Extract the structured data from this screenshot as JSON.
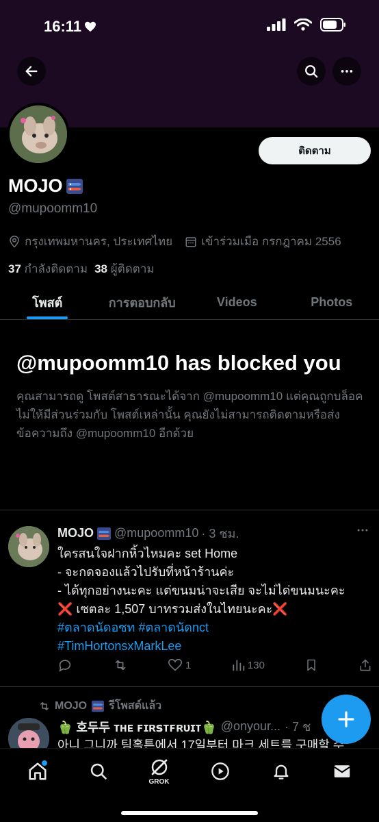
{
  "status_bar": {
    "time": "16:11"
  },
  "profile": {
    "display_name": "MOJO",
    "handle": "@mupoomm10",
    "follow_label": "ติดตาม",
    "location": "กรุงเทพมหานคร, ประเทศไทย",
    "joined": "เข้าร่วมเมือ กรกฎาคม 2556",
    "following_count": "37",
    "following_label": "กำลังติดตาม",
    "followers_count": "38",
    "followers_label": "ผู้ติดตาม"
  },
  "tabs": [
    {
      "label": "โพสต์",
      "active": true
    },
    {
      "label": "การตอบกลับ",
      "active": false
    },
    {
      "label": "Videos",
      "active": false
    },
    {
      "label": "Photos",
      "active": false
    }
  ],
  "blocked": {
    "title": "@mupoomm10 has blocked you",
    "description": "คุณสามารถดู โพสต์สาธารณะได้จาก @mupoomm10 แต่คุณถูกบล็อคไม่ให้มีส่วนร่วมกับ โพสต์เหล่านั้น คุณยังไม่สามารถติดตามหรือส่งข้อความถึง @mupoomm10 อีกด้วย"
  },
  "post": {
    "name": "MOJO",
    "handle": "@mupoomm10",
    "time": "· 3 ชม.",
    "line1": "ใครสนใจฝากหิ้วไหมคะ set Home",
    "line2": "- จะกดจองแล้วไปรับที่หน้าร้านค่ะ",
    "line3": "- ได้ทุกอย่างนะคะ แต่ขนมน่าจะเสีย จะไม่ได่ขนมนะคะ",
    "line4_mark": "❌",
    "line4": " เซตละ 1,507 บาทรวมส่งในไทยนะคะ",
    "tag1": "#ตลาดนัดอซท",
    "tag2": "#ตลาดนัดnct",
    "tag3": "#TimHortonsxMarkLee",
    "likes": "1",
    "views": "130"
  },
  "repost": {
    "reposter": "MOJO",
    "reposted_label": "รีโพสต์แล้ว",
    "author": "🫑 호두두 ᴛʜᴇ ꜰɪʀꜱᴛꜰʀᴜɪᴛ🫑",
    "handle": "@onyour...",
    "time": "· 7 ช",
    "text": "아니 그니까 팀홀튼에서 17일부터 마크 세트를 구매할 수"
  },
  "nav": {
    "grok_label": "GROK"
  },
  "colors": {
    "accent": "#1d9bf0",
    "banner": "#1c0a22",
    "background": "#000000"
  },
  "icons": [
    "back-arrow-icon",
    "search-icon",
    "more-icon",
    "location-icon",
    "calendar-icon",
    "reply-icon",
    "repost-icon",
    "like-icon",
    "views-icon",
    "bookmark-icon",
    "share-icon",
    "compose-icon",
    "home-icon",
    "grok-icon",
    "video-icon",
    "bell-icon",
    "mail-icon"
  ]
}
